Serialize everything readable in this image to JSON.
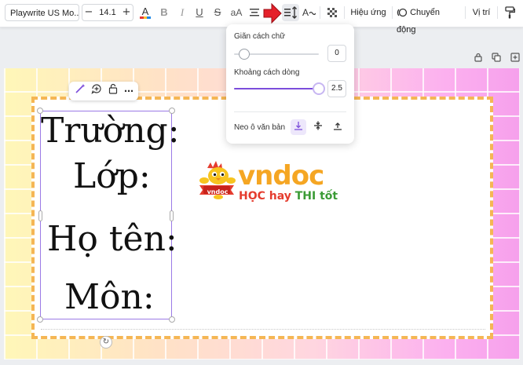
{
  "toolbar": {
    "font": "Playwrite US Mo...",
    "font_size": "14.1",
    "minus": "−",
    "plus": "+",
    "case_label": "aA",
    "effects_label": "Hiệu ứng",
    "animate_label": "Chuyển động",
    "position_label": "Vị trí"
  },
  "popup": {
    "letter_spacing_label": "Giãn cách chữ",
    "letter_spacing_value": "0",
    "letter_spacing_fraction": 0.12,
    "line_spacing_label": "Khoảng cách dòng",
    "line_spacing_value": "2.5",
    "line_spacing_fraction": 1.0,
    "anchor_label": "Neo ô văn bản"
  },
  "textbox": {
    "line1": "Trường:",
    "line2": "Lớp:",
    "line3": "Họ tên:",
    "line4": "Môn:"
  },
  "logo": {
    "word": "vndoc",
    "badge": "vndoc",
    "slogan_hoc": "HỌC hay ",
    "slogan_thi": "THI tốt"
  },
  "colors": {
    "accent": "#7c4ddb",
    "arrow": "#e5202a",
    "border_dashed": "#f5b654",
    "logo_orange": "#f5a623",
    "slogan_red": "#e53c2e",
    "slogan_green": "#3a9b35"
  }
}
